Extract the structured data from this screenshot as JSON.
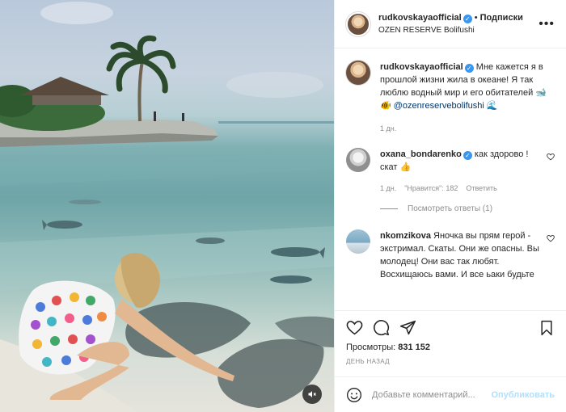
{
  "post": {
    "username": "rudkovskayaofficial",
    "follow_label": "Подписки",
    "location": "OZEN RESERVE Bolifushi",
    "more_label": "•••"
  },
  "caption": {
    "username": "rudkovskayaofficial",
    "text": "Мне кажется я в прошлой жизни жила в океане! Я так люблю водный мир и его обитателей 🐋🐠",
    "mention": "@ozenreservebolifushi",
    "emoji": "🌊",
    "time": "1 дн."
  },
  "comments": [
    {
      "username": "oxana_bondarenko",
      "verified": true,
      "text": "как здорово ! скат 👍",
      "time": "1 дн.",
      "likes": "\"Нравится\": 182",
      "reply_label": "Ответить",
      "replies_label": "Посмотреть ответы (1)"
    },
    {
      "username": "nkomzikova",
      "verified": false,
      "text": "Яночка вы прям герой - экстримал. Скаты. Они же опасны. Вы молодец! Они вас так любят. Восхищаюсь вами. И все ьаки будьте"
    }
  ],
  "stats": {
    "views_label": "Просмотры:",
    "views_value": "831 152",
    "date": "ДЕНЬ НАЗАД"
  },
  "add_comment": {
    "placeholder": "Добавьте комментарий...",
    "publish_label": "Опубликовать"
  },
  "icons": [
    "heart-icon",
    "comment-icon",
    "share-icon",
    "bookmark-icon",
    "mute-icon",
    "emoji-icon"
  ],
  "colors": {
    "link": "#00376b",
    "verified": "#3897f0",
    "publish": "#b2dffc",
    "meta": "#8e8e8e"
  }
}
